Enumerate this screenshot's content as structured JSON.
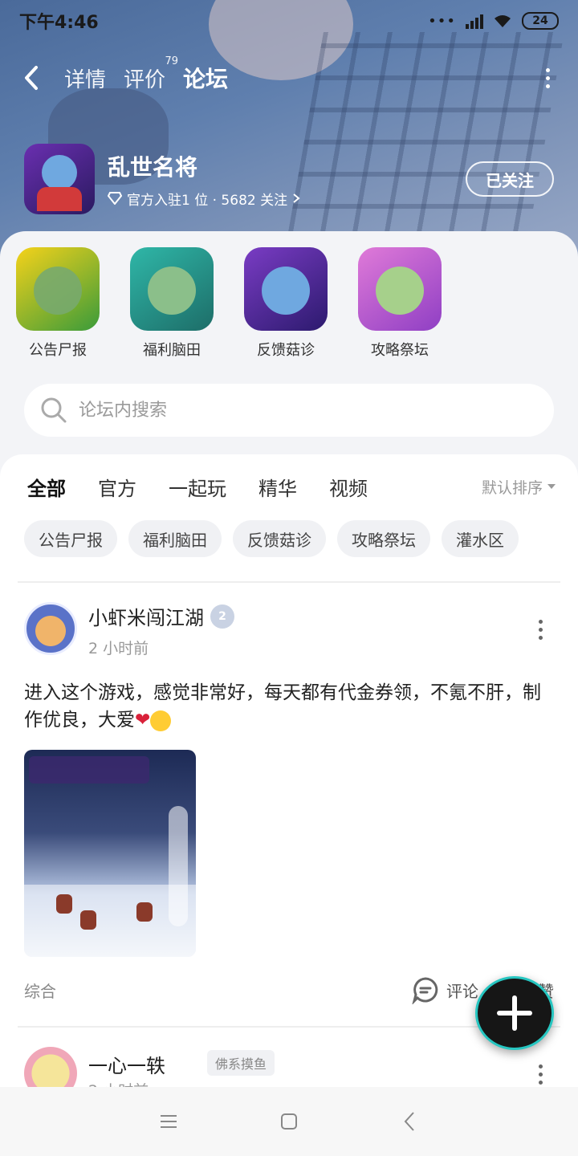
{
  "status_bar": {
    "time": "下午4:46",
    "battery": "24",
    "network": "HD"
  },
  "nav": {
    "tabs": [
      {
        "label": "详情",
        "sup": ""
      },
      {
        "label": "评价",
        "sup": "79"
      },
      {
        "label": "论坛",
        "sup": ""
      }
    ],
    "active_tab": "论坛"
  },
  "game": {
    "name": "乱世名将",
    "meta": "官方入驻1 位 · 5682 关注",
    "follow_label": "已关注"
  },
  "boards": [
    {
      "label": "公告尸报",
      "icon": "board-announcement-icon"
    },
    {
      "label": "福利脑田",
      "icon": "board-welfare-icon"
    },
    {
      "label": "反馈菇诊",
      "icon": "board-feedback-icon"
    },
    {
      "label": "攻略祭坛",
      "icon": "board-guide-icon"
    }
  ],
  "search": {
    "placeholder": "论坛内搜索"
  },
  "feed_tabs": [
    "全部",
    "官方",
    "一起玩",
    "精华",
    "视频"
  ],
  "sort_label": "默认排序",
  "chips": [
    "公告尸报",
    "福利脑田",
    "反馈菇诊",
    "攻略祭坛",
    "灌水区"
  ],
  "post": {
    "author": "小虾米闯江湖",
    "level": "2",
    "time": "2 小时前",
    "body": "进入这个游戏，感觉非常好，每天都有代金券领，不氪不肝，制作优良，大爱",
    "category": "综合",
    "comment_label": "评论",
    "like_label": "赞"
  },
  "post2": {
    "author": "一心一轶",
    "tag": "佛系摸鱼",
    "time": "2 小时前"
  },
  "colors": {
    "accent": "#22d3c5",
    "banner": "#5f7fae",
    "heart": "#d9213a"
  }
}
